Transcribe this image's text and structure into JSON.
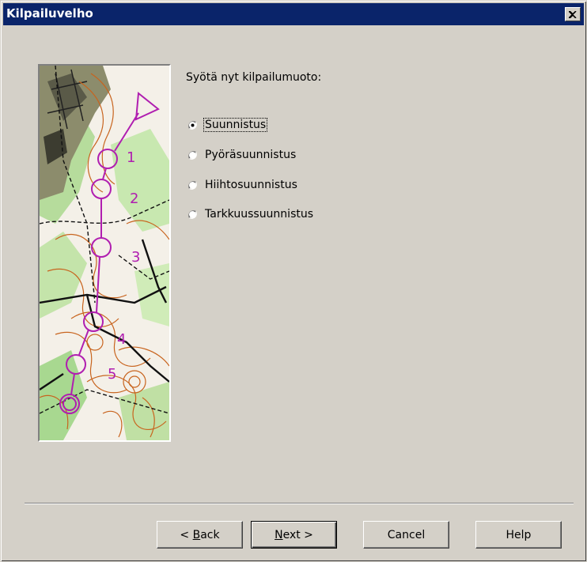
{
  "window": {
    "title": "Kilpailuvelho"
  },
  "prompt": "Syötä nyt kilpailumuoto:",
  "options": [
    {
      "label": "Suunnistus",
      "selected": true
    },
    {
      "label": "Pyöräsuunnistus",
      "selected": false
    },
    {
      "label": "Hiihtosuunnistus",
      "selected": false
    },
    {
      "label": "Tarkkuussuunnistus",
      "selected": false
    }
  ],
  "map": {
    "control_numbers": [
      "1",
      "2",
      "3",
      "4",
      "5"
    ]
  },
  "buttons": {
    "back": {
      "pre": "< ",
      "accel": "B",
      "post": "ack"
    },
    "next": {
      "pre": "",
      "accel": "N",
      "post": "ext >"
    },
    "cancel": "Cancel",
    "help": "Help"
  },
  "colors": {
    "titlebar": "#0a246a",
    "face": "#d4d0c8",
    "course": "#b01eb0",
    "contour": "#c8641e",
    "vegetation": "#a8d890"
  }
}
